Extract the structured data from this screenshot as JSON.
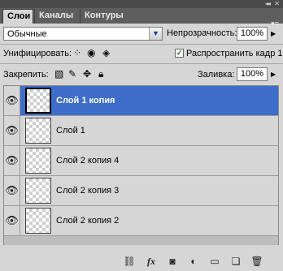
{
  "tabs": [
    {
      "label": "Слои"
    },
    {
      "label": "Каналы"
    },
    {
      "label": "Контуры"
    }
  ],
  "panel_controls": {
    "collapse": "◂◂",
    "close": "✕",
    "menu": "▾≡"
  },
  "blend_mode": {
    "value": "Обычные"
  },
  "opacity": {
    "label": "Непрозрачность:",
    "value": "100%"
  },
  "unify": {
    "label": "Унифицировать:"
  },
  "propagate": {
    "label": "Распространить кадр 1",
    "checked": true
  },
  "lock": {
    "label": "Закрепить:"
  },
  "fill": {
    "label": "Заливка:",
    "value": "100%"
  },
  "layers": [
    {
      "name": "Слой 1 копия",
      "selected": true
    },
    {
      "name": "Слой 1",
      "selected": false
    },
    {
      "name": "Слой 2 копия 4",
      "selected": false
    },
    {
      "name": "Слой 2 копия 3",
      "selected": false
    },
    {
      "name": "Слой 2 копия 2",
      "selected": false
    }
  ],
  "bottom_icons": [
    "link-layers-icon",
    "fx-icon",
    "layer-mask-icon",
    "adjustment-layer-icon",
    "new-group-icon",
    "new-layer-icon",
    "trash-icon"
  ],
  "bottom_fx": "fx",
  "colors": {
    "selected_row": "#3d6ec9",
    "panel_bg": "#d6d6d6",
    "tab_bar": "#5e5e5e"
  }
}
